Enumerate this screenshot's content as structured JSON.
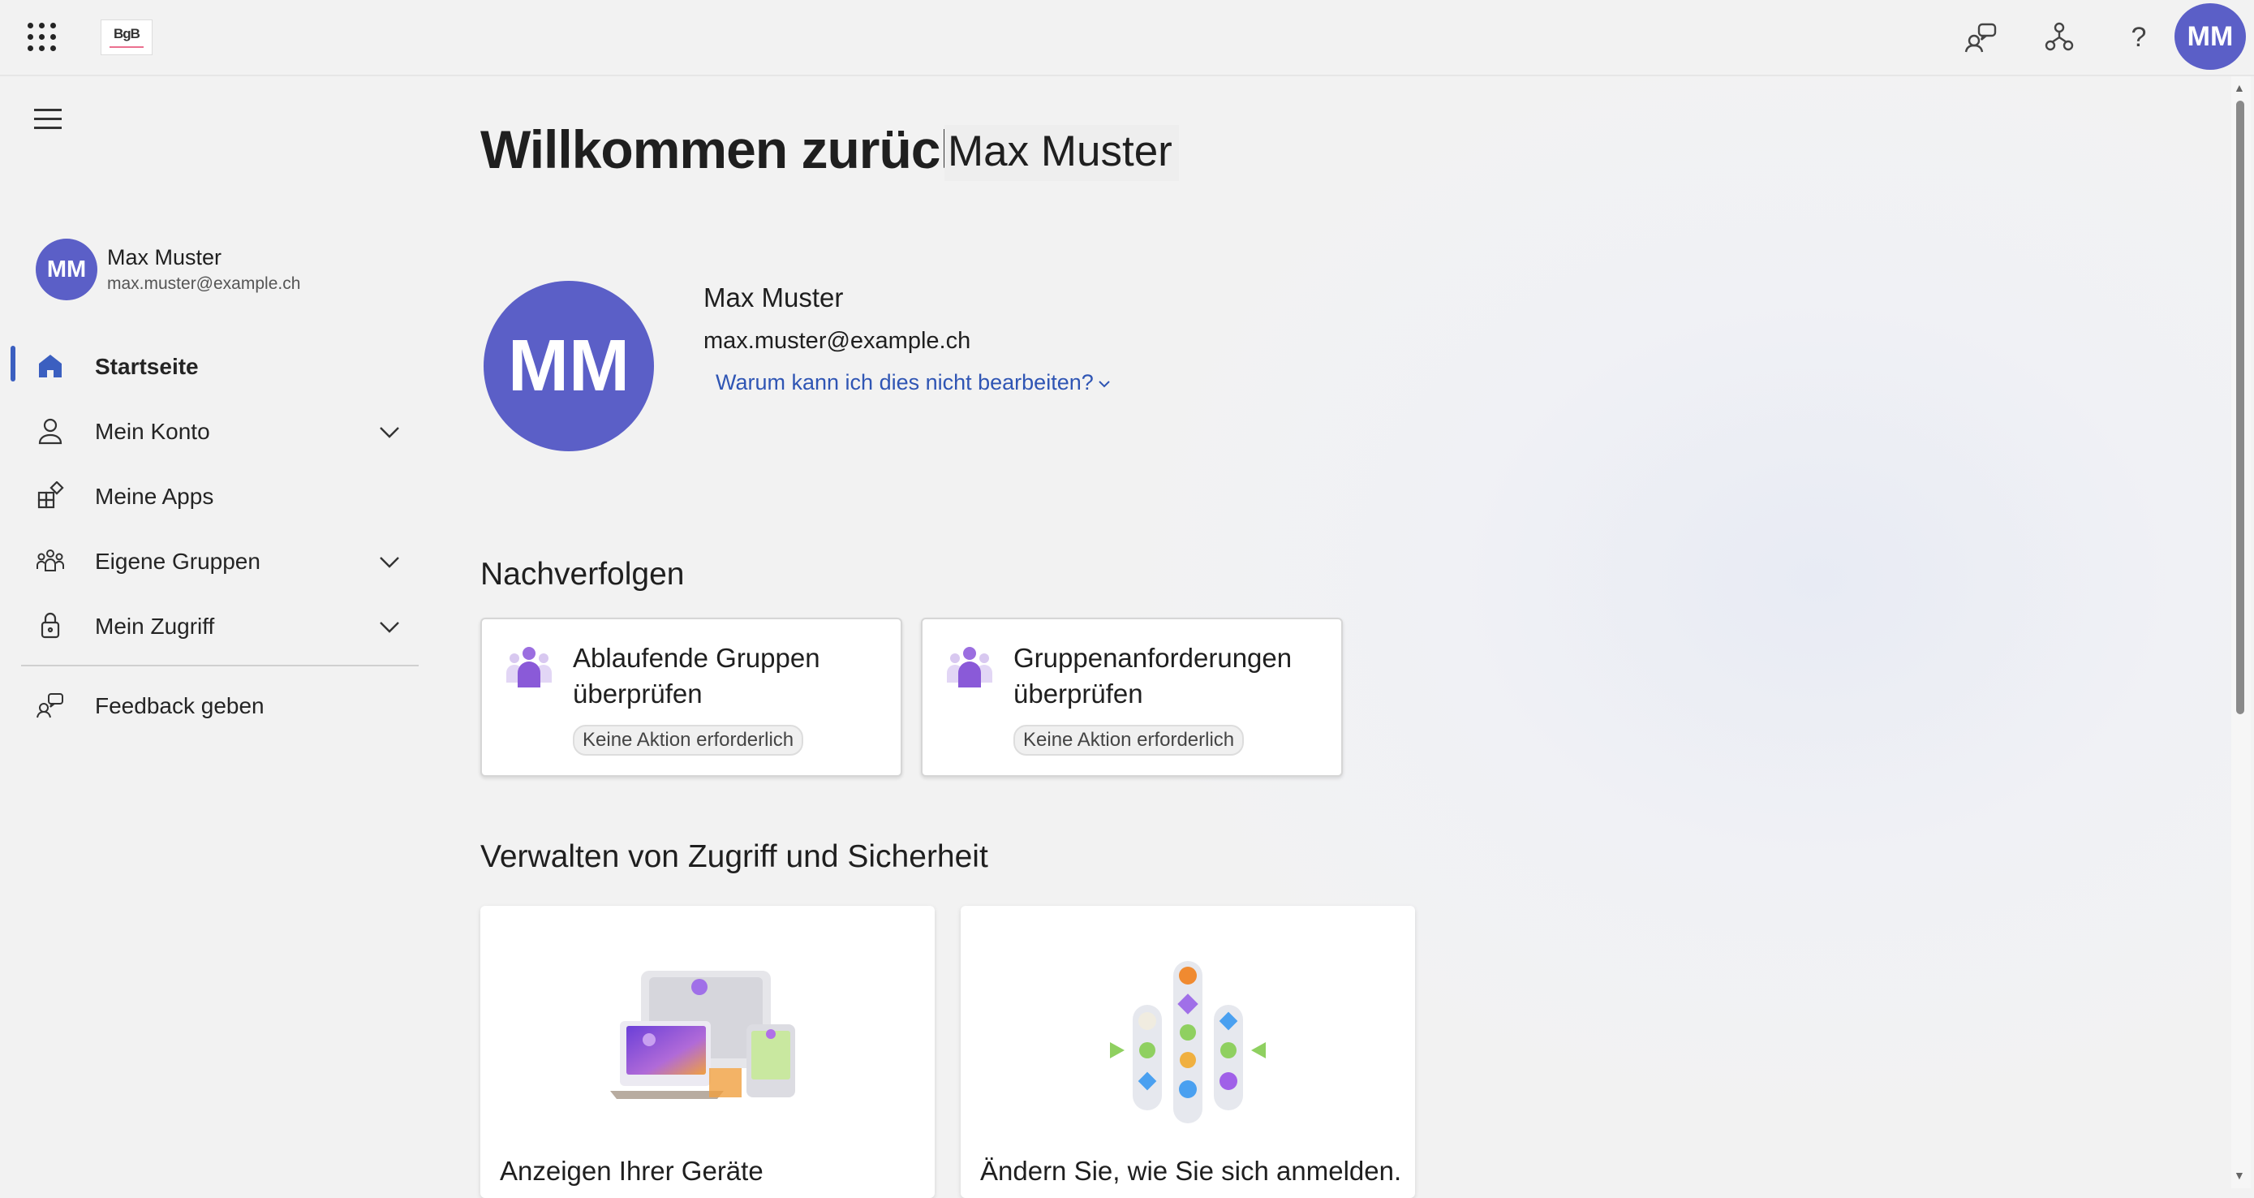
{
  "header": {
    "logo_text": "BgB",
    "help_label": "?",
    "avatar_initials": "MM"
  },
  "sidebar": {
    "user_initials": "MM",
    "user_name": "Max Muster",
    "user_email": "max.muster@example.ch",
    "items": [
      {
        "label": "Startseite",
        "icon": "home-icon",
        "active": true
      },
      {
        "label": "Mein Konto",
        "icon": "person-icon",
        "expandable": true
      },
      {
        "label": "Meine Apps",
        "icon": "apps-icon"
      },
      {
        "label": "Eigene Gruppen",
        "icon": "groups-icon",
        "expandable": true
      },
      {
        "label": "Mein Zugriff",
        "icon": "lock-icon",
        "expandable": true
      }
    ],
    "feedback_label": "Feedback geben"
  },
  "main": {
    "welcome": "Willkommen zurück,",
    "welcome_name": "Max Muster",
    "profile": {
      "initials": "MM",
      "name": "Max Muster",
      "email": "max.muster@example.ch",
      "edit_link": "Warum kann ich dies nicht bearbeiten?"
    },
    "follow_title": "Nachverfolgen",
    "follow_cards": [
      {
        "line1": "Ablaufende Gruppen",
        "line2": "überprüfen",
        "badge": "Keine Aktion erforderlich"
      },
      {
        "line1": "Gruppenanforderungen",
        "line2": "überprüfen",
        "badge": "Keine Aktion erforderlich"
      }
    ],
    "manage_title": "Verwalten von Zugriff und Sicherheit",
    "manage_tiles": [
      {
        "title": "Anzeigen Ihrer Geräte"
      },
      {
        "title": "Ändern Sie, wie Sie sich anmelden."
      }
    ]
  },
  "colors": {
    "accent": "#5b5fc7",
    "link": "#2f55b4",
    "active_indicator": "#3b5fc0"
  }
}
